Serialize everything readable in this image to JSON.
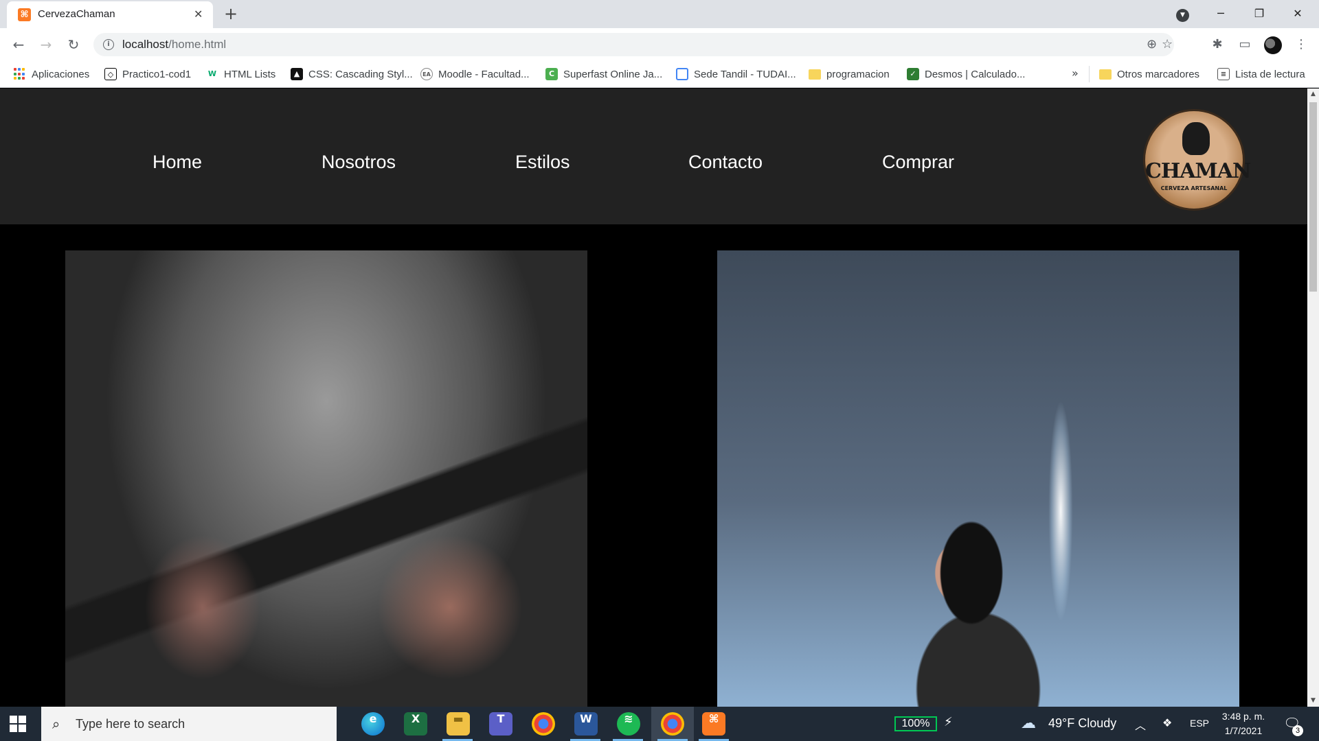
{
  "browser": {
    "tab": {
      "title": "CervezaChaman",
      "favicon": "xampp-icon"
    },
    "url": {
      "host": "localhost",
      "path": "/home.html"
    },
    "bookmarks": [
      {
        "label": "Aplicaciones",
        "icon": "apps-icon"
      },
      {
        "label": "Practico1-cod1",
        "icon": "codepen-icon"
      },
      {
        "label": "HTML Lists",
        "icon": "w3schools-icon"
      },
      {
        "label": "CSS: Cascading Styl...",
        "icon": "mdn-icon"
      },
      {
        "label": "Moodle - Facultad...",
        "icon": "moodle-icon"
      },
      {
        "label": "Superfast Online Ja...",
        "icon": "compiler-icon"
      },
      {
        "label": "Sede Tandil - TUDAI...",
        "icon": "page-icon"
      },
      {
        "label": "programacion",
        "icon": "folder-icon"
      },
      {
        "label": "Desmos | Calculado...",
        "icon": "desmos-icon"
      }
    ],
    "bookmarks_more": "»",
    "other_bookmarks": "Otros marcadores",
    "reading_list": "Lista de lectura"
  },
  "site": {
    "nav": [
      "Home",
      "Nosotros",
      "Estilos",
      "Contacto",
      "Comprar"
    ],
    "logo": {
      "title": "CHAMAN",
      "subtitle": "CERVEZA ARTESANAL"
    },
    "photos": [
      "tattooed-hands-knife-photo",
      "singer-microphone-photo"
    ]
  },
  "taskbar": {
    "search_placeholder": "Type here to search",
    "apps": [
      "edge-icon",
      "excel-icon",
      "file-explorer-icon",
      "teams-icon",
      "chrome-profile-icon",
      "word-icon",
      "spotify-icon",
      "chrome-icon",
      "xampp-icon"
    ],
    "battery": "100%",
    "weather": "49°F  Cloudy",
    "language": "ESP",
    "time": "3:48 p. m.",
    "date": "1/7/2021",
    "notifications": "3"
  },
  "colors": {
    "site_header": "#222222",
    "page_bg": "#000000",
    "taskbar": "#202a36",
    "xampp_orange": "#fb7a24"
  }
}
